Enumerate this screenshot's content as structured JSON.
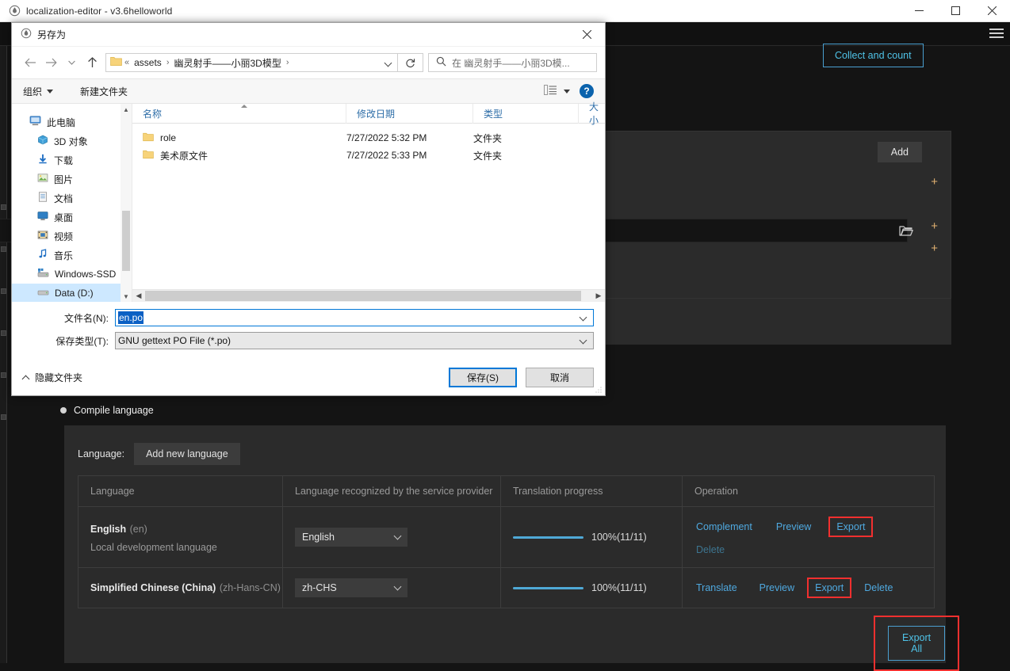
{
  "app": {
    "title": "localization-editor - v3.6helloworld",
    "title_icon": "app-drop-icon",
    "window_controls": {
      "minimize": "─",
      "maximize": "□",
      "close": "✕"
    },
    "menu_icon": "hamburger-menu-icon",
    "config_card": {
      "add_button": "Add",
      "plus_icon": "+",
      "folder_icon": "open-folder-icon"
    },
    "collect_button": "Collect and count",
    "compile_section": {
      "radio_label": "Compile language"
    },
    "language_panel": {
      "language_label": "Language:",
      "add_new_language_button": "Add new language",
      "columns": [
        "Language",
        "Language recognized by the service provider",
        "Translation progress",
        "Operation"
      ],
      "rows": [
        {
          "name": "English",
          "code": "(en)",
          "sub": "Local development language",
          "service_language": "English",
          "progress_percent": 100,
          "progress_text": "100%(11/11)",
          "operations": [
            {
              "label": "Complement",
              "state": "enabled",
              "highlighted": false
            },
            {
              "label": "Preview",
              "state": "enabled",
              "highlighted": false
            },
            {
              "label": "Export",
              "state": "enabled",
              "highlighted": true
            },
            {
              "label": "Delete",
              "state": "disabled",
              "highlighted": false
            }
          ]
        },
        {
          "name": "Simplified Chinese (China)",
          "code": "(zh-Hans-CN)",
          "sub": "",
          "service_language": "zh-CHS",
          "progress_percent": 100,
          "progress_text": "100%(11/11)",
          "operations": [
            {
              "label": "Translate",
              "state": "enabled",
              "highlighted": false
            },
            {
              "label": "Preview",
              "state": "enabled",
              "highlighted": false
            },
            {
              "label": "Export",
              "state": "enabled",
              "highlighted": true
            },
            {
              "label": "Delete",
              "state": "enabled",
              "highlighted": false
            }
          ]
        }
      ]
    },
    "export_all_button": "Export All"
  },
  "dialog": {
    "title": "另存为",
    "title_icon": "app-drop-icon",
    "close_label": "✕",
    "nav": {
      "back_icon": "arrow-left-icon",
      "forward_icon": "arrow-right-icon",
      "recent_icon": "chevron-down-icon",
      "up_icon": "arrow-up-icon",
      "refresh_icon": "refresh-icon",
      "breadcrumb_prefix": "«",
      "breadcrumb": [
        "assets",
        "幽灵射手——小丽3D模型"
      ],
      "breadcrumb_separator": "›"
    },
    "search": {
      "icon": "search-icon",
      "placeholder": "在 幽灵射手——小丽3D模..."
    },
    "command_bar": {
      "organize": "组织",
      "new_folder": "新建文件夹",
      "view_icon": "list-view-icon",
      "help_label": "?"
    },
    "tree": [
      {
        "label": "此电脑",
        "icon": "computer-icon",
        "indent": 0,
        "selected": false
      },
      {
        "label": "3D 对象",
        "icon": "cube-icon",
        "indent": 1,
        "selected": false
      },
      {
        "label": "下载",
        "icon": "download-icon",
        "indent": 1,
        "selected": false
      },
      {
        "label": "图片",
        "icon": "pictures-icon",
        "indent": 1,
        "selected": false
      },
      {
        "label": "文档",
        "icon": "documents-icon",
        "indent": 1,
        "selected": false
      },
      {
        "label": "桌面",
        "icon": "desktop-icon",
        "indent": 1,
        "selected": false
      },
      {
        "label": "视频",
        "icon": "videos-icon",
        "indent": 1,
        "selected": false
      },
      {
        "label": "音乐",
        "icon": "music-icon",
        "indent": 1,
        "selected": false
      },
      {
        "label": "Windows-SSD",
        "icon": "drive-windows-icon",
        "indent": 1,
        "selected": false
      },
      {
        "label": "Data (D:)",
        "icon": "drive-icon",
        "indent": 1,
        "selected": true
      }
    ],
    "list": {
      "columns": [
        "名称",
        "修改日期",
        "类型",
        "大小"
      ],
      "rows": [
        {
          "name": "role",
          "icon": "folder-icon",
          "date": "7/27/2022 5:32 PM",
          "type": "文件夹",
          "size": ""
        },
        {
          "name": "美术原文件",
          "icon": "folder-icon",
          "date": "7/27/2022 5:33 PM",
          "type": "文件夹",
          "size": ""
        }
      ]
    },
    "fields": {
      "filename_label": "文件名(N):",
      "filename_value": "en.po",
      "filetype_label": "保存类型(T):",
      "filetype_value": "GNU gettext PO File (*.po)"
    },
    "footer": {
      "hide_folders": "隐藏文件夹",
      "save_button": "保存(S)",
      "cancel_button": "取消"
    }
  },
  "colors": {
    "accent_blue": "#4fa9e0",
    "highlight_red": "#f2302f",
    "progress_blue": "#4fa9d6",
    "panel_bg": "#2b2b2b",
    "app_bg": "#141414",
    "dialog_bg": "#ffffff",
    "selection_blue": "#0b60c4"
  }
}
